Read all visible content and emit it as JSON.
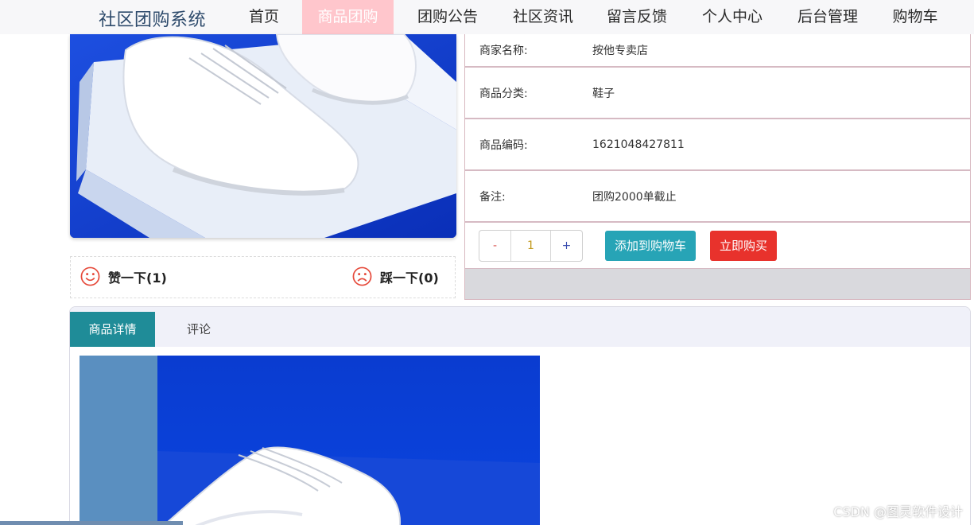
{
  "nav": {
    "brand": "社区团购系统",
    "items": [
      {
        "label": "首页"
      },
      {
        "label": "商品团购",
        "active": true
      },
      {
        "label": "团购公告"
      },
      {
        "label": "社区资讯"
      },
      {
        "label": "留言反馈"
      },
      {
        "label": "个人中心"
      },
      {
        "label": "后台管理"
      },
      {
        "label": "购物车"
      }
    ]
  },
  "product": {
    "image_icon": "white-sneaker-image",
    "votes": {
      "like_label": "赞一下(1)",
      "dislike_label": "踩一下(0)"
    },
    "info": [
      {
        "label": "商家名称:",
        "value": "按他专卖店"
      },
      {
        "label": "商品分类:",
        "value": "鞋子"
      },
      {
        "label": "商品编码:",
        "value": "1621048427811"
      },
      {
        "label": "备注:",
        "value": "团购2000单截止"
      }
    ],
    "quantity": {
      "minus": "-",
      "value": "1",
      "plus": "+"
    },
    "add_cart_label": "添加到购物车",
    "buy_now_label": "立即购买"
  },
  "tabs": [
    {
      "label": "商品详情",
      "active": true
    },
    {
      "label": "评论",
      "active": false
    }
  ],
  "detail": {
    "image_icon": "white-sneaker-detail-image"
  },
  "watermark": "CSDN @图灵软件设计",
  "colors": {
    "nav_active": "#ffc6cc",
    "tab_active": "#1f8c98",
    "add_cart": "#27a4b6",
    "buy_now": "#e8322c",
    "row_border": "#d6bac3"
  }
}
